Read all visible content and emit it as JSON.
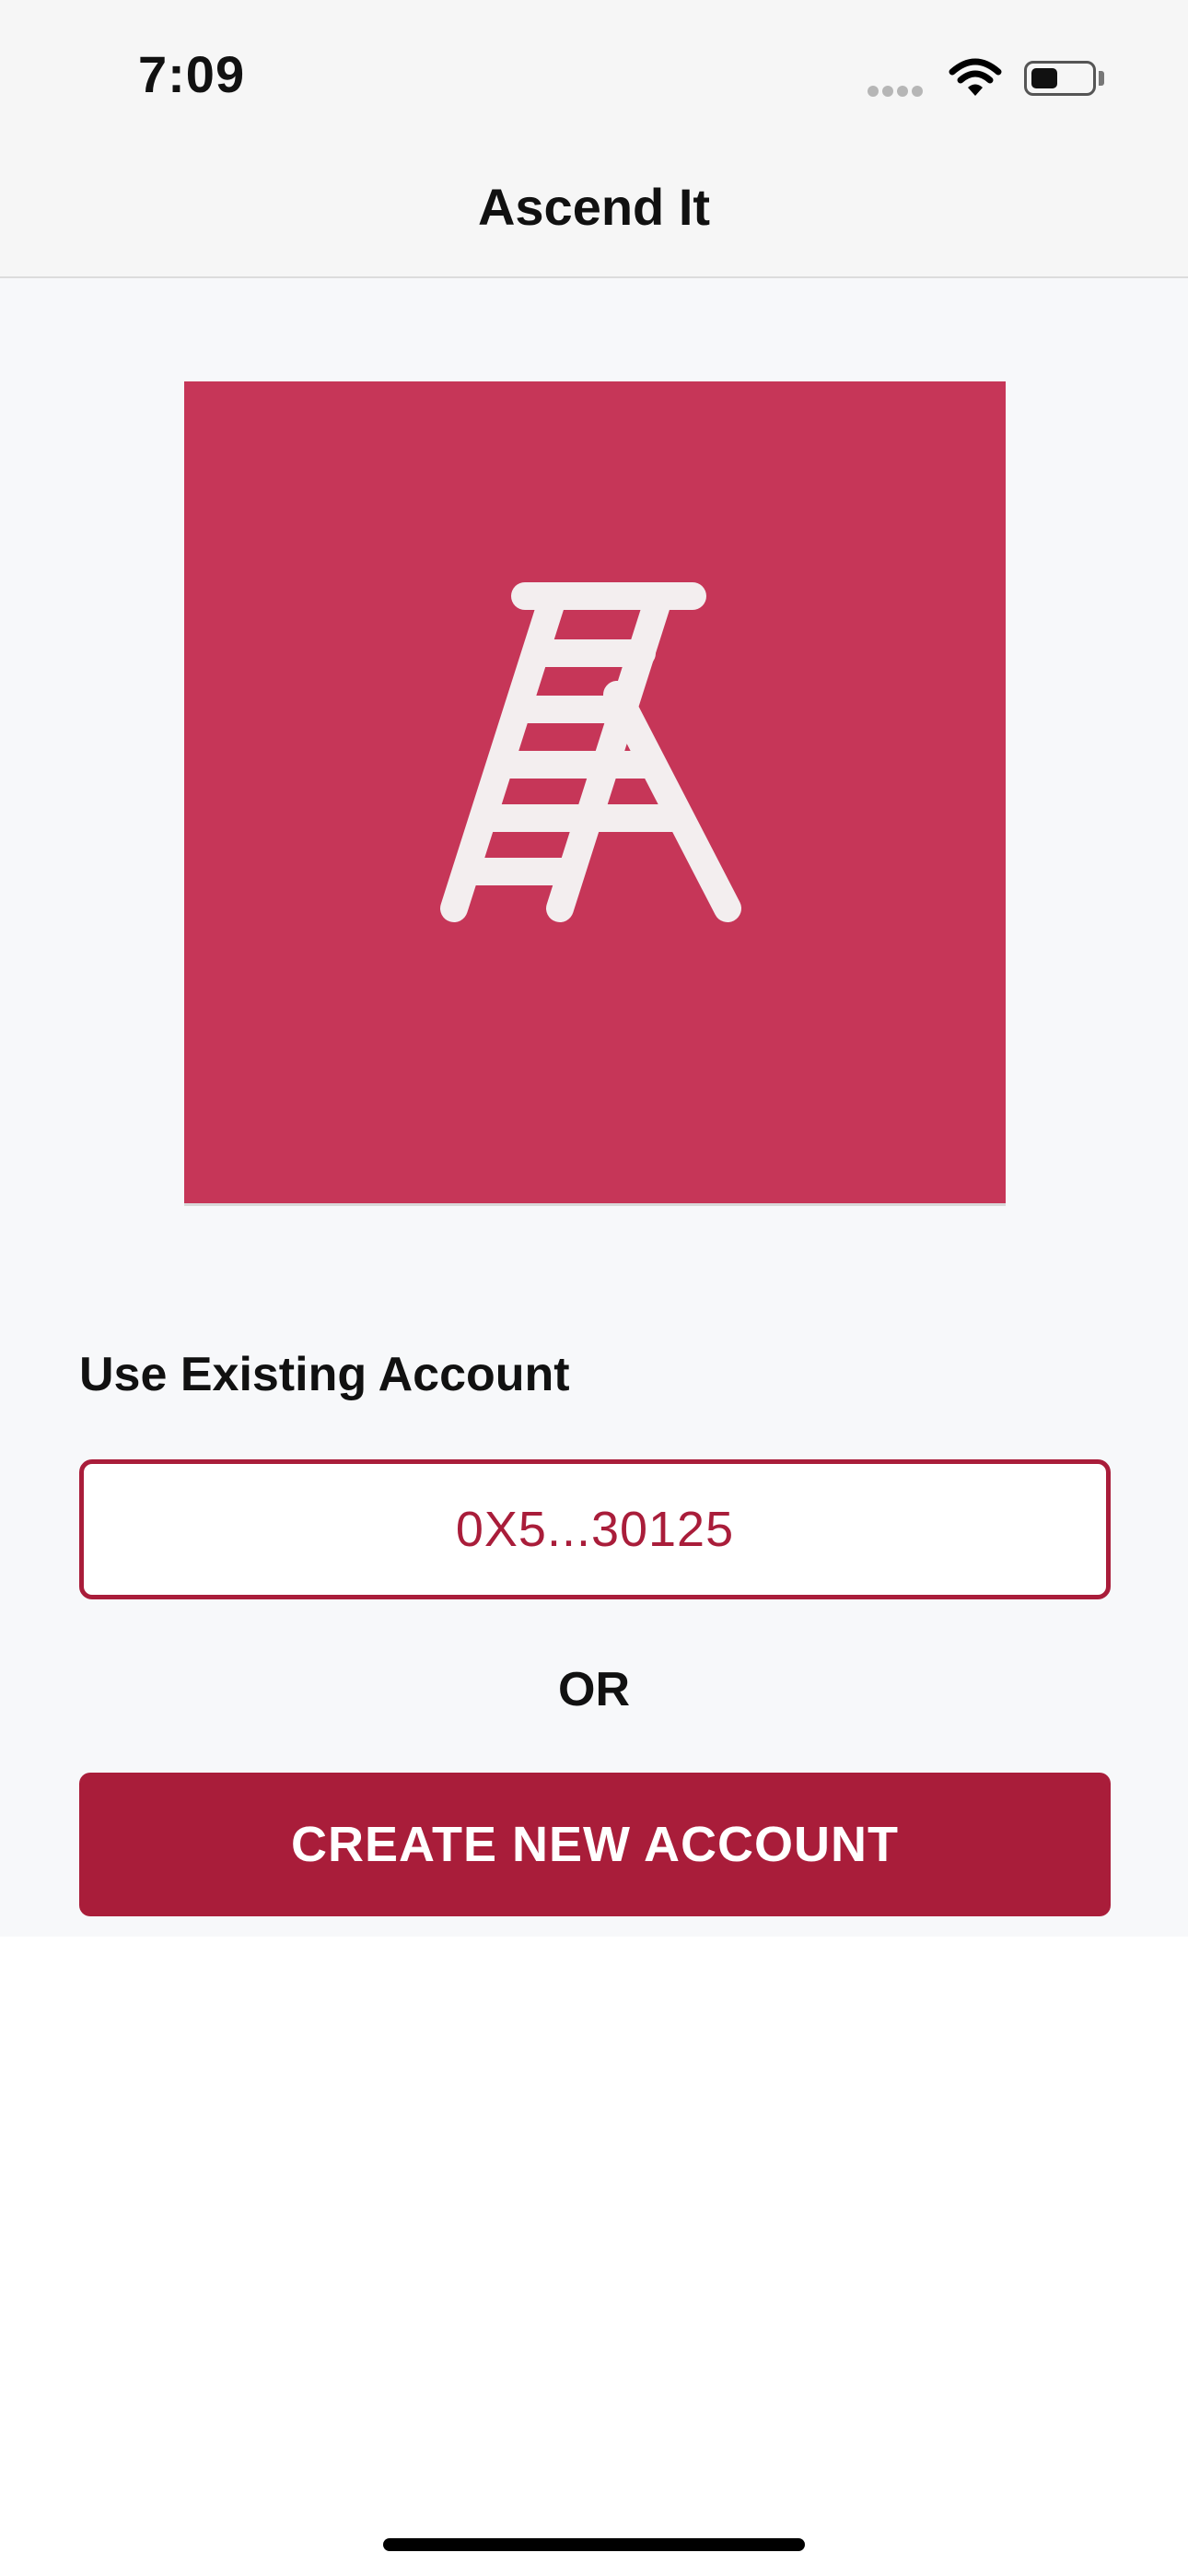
{
  "status_bar": {
    "time": "7:09",
    "icons": [
      "cellular-signal-icon",
      "wifi-icon",
      "battery-icon"
    ],
    "battery_level": 0.45
  },
  "nav": {
    "title": "Ascend It"
  },
  "logo": {
    "icon": "ladder-icon",
    "background_color": "#c63658",
    "icon_color": "#f3eeef"
  },
  "existing_account": {
    "label": "Use Existing Account",
    "account_button_label": "0X5...30125"
  },
  "divider_text": "OR",
  "create_account": {
    "label": "CREATE NEW ACCOUNT"
  },
  "colors": {
    "accent": "#a91d3a",
    "content_background": "#f7f8fa",
    "bar_background": "#f6f6f6"
  }
}
